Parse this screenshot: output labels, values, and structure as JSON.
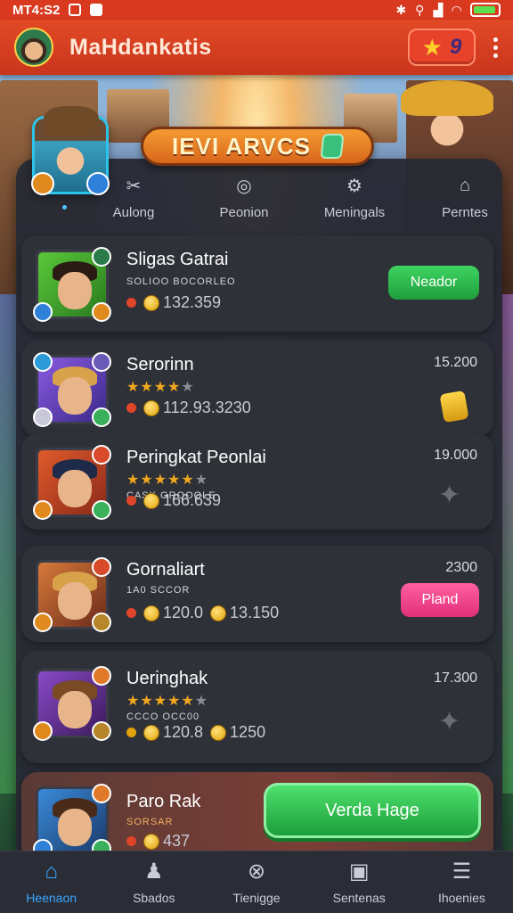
{
  "status_bar": {
    "time": "MT4:S2",
    "icons": [
      "gallery-icon",
      "app-icon",
      "bluetooth-icon",
      "location-icon",
      "signal-icon",
      "wifi-icon",
      "battery-icon"
    ]
  },
  "app_bar": {
    "title": "MaHdankatis",
    "star_count": "9"
  },
  "banner": {
    "title": "IEVI ARVCS"
  },
  "categories": [
    {
      "label": "Aulong",
      "icon": "tools-icon"
    },
    {
      "label": "Peonion",
      "icon": "target-icon"
    },
    {
      "label": "Meningals",
      "icon": "gear-icon"
    },
    {
      "label": "Perntes",
      "icon": "lock-icon"
    }
  ],
  "cards": [
    {
      "name": "Sligas Gatrai",
      "subline": "SOLIOO BOCORLEO",
      "coins": "132.359",
      "button": "Neador"
    },
    {
      "name": "Serorinn",
      "stars_on": 4,
      "stars_total": 5,
      "coins": "112.93.3230",
      "right_value": "15.200"
    },
    {
      "name": "Peringkat Peonlai",
      "stars_on": 5,
      "stars_total": 6,
      "subline": "CASK GROOOLE",
      "coins": "166.639",
      "right_value": "19.000"
    },
    {
      "name": "Gornaliart",
      "subline": "1A0 SCCOR",
      "coins": "120.0",
      "coins2": "13.150",
      "right_value": "2300",
      "button": "Pland"
    },
    {
      "name": "Ueringhak",
      "stars_on": 5,
      "stars_total": 6,
      "subline": "CCCO OCC00",
      "coins": "120.8",
      "coins2": "1250",
      "right_value": "17.300"
    },
    {
      "name": "Paro Rak",
      "subline": "SORSAR",
      "coins": "437",
      "button": "Verda Hage"
    }
  ],
  "bottom_nav": [
    {
      "label": "Heenaon",
      "icon": "home-icon",
      "active": true
    },
    {
      "label": "Sbados",
      "icon": "user-icon",
      "active": false
    },
    {
      "label": "Tienigge",
      "icon": "compass-icon",
      "active": false
    },
    {
      "label": "Sentenas",
      "icon": "chart-icon",
      "active": false
    },
    {
      "label": "Ihoenies",
      "icon": "menu-icon",
      "active": false
    }
  ],
  "colors": {
    "app_bar": "#d9391f",
    "accent_blue": "#3aa6ff",
    "green_button": "#2ebd4e",
    "pink_button": "#ff4f93",
    "panel": "#282a34"
  }
}
